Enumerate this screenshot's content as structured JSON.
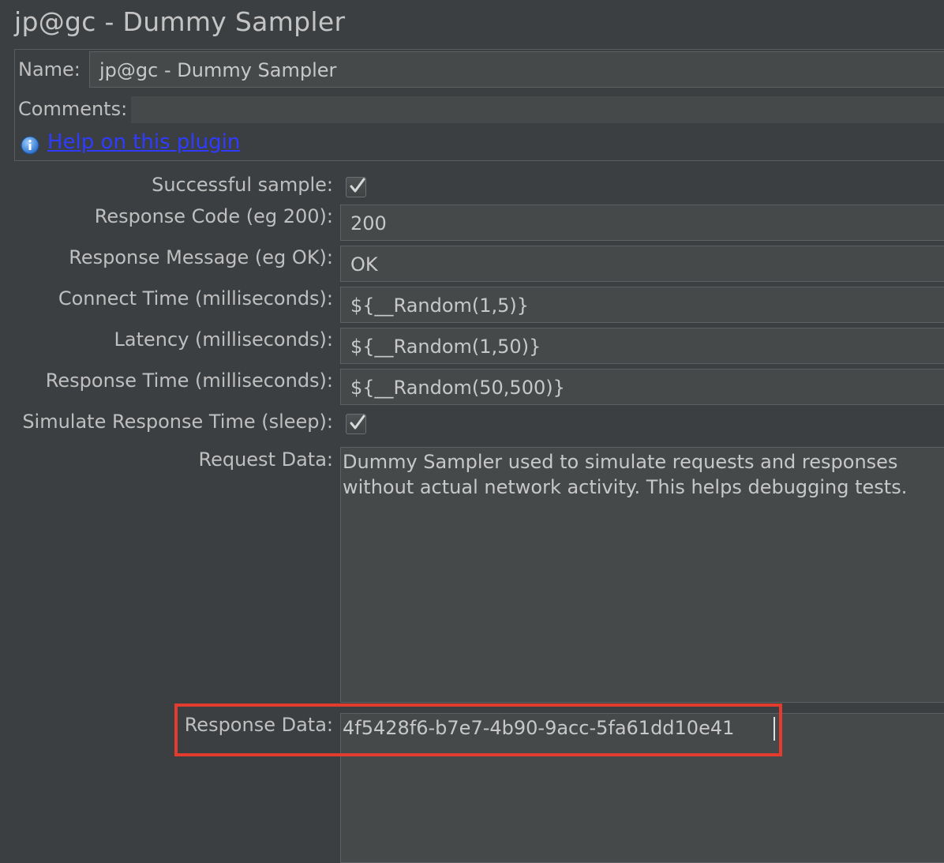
{
  "window": {
    "title": "jp@gc - Dummy Sampler"
  },
  "header": {
    "name_label": "Name:",
    "name_value": "jp@gc - Dummy Sampler",
    "comments_label": "Comments:",
    "comments_value": "",
    "help_link": "Help on this plugin"
  },
  "form": {
    "successful_sample": {
      "label": "Successful sample:",
      "checked": true
    },
    "response_code": {
      "label": "Response Code (eg 200):",
      "value": "200"
    },
    "response_message": {
      "label": "Response Message (eg OK):",
      "value": "OK"
    },
    "connect_time": {
      "label": "Connect Time (milliseconds):",
      "value": "${__Random(1,5)}"
    },
    "latency": {
      "label": "Latency (milliseconds):",
      "value": "${__Random(1,50)}"
    },
    "response_time": {
      "label": "Response Time (milliseconds):",
      "value": "${__Random(50,500)}"
    },
    "simulate_sleep": {
      "label": "Simulate Response Time (sleep):",
      "checked": true
    },
    "request_data": {
      "label": "Request Data:",
      "value": "Dummy Sampler used to simulate requests and responses\nwithout actual network activity. This helps debugging tests."
    },
    "response_data": {
      "label": "Response Data:",
      "value": "4f5428f6-b7e7-4b90-9acc-5fa61dd10e41"
    }
  },
  "colors": {
    "background": "#3c3f41",
    "field_background": "#45494a",
    "link": "#2f3cff",
    "highlight_box": "#e33b2e"
  },
  "icons": {
    "info": "info-icon",
    "checkbox_check": "checkmark-icon"
  }
}
